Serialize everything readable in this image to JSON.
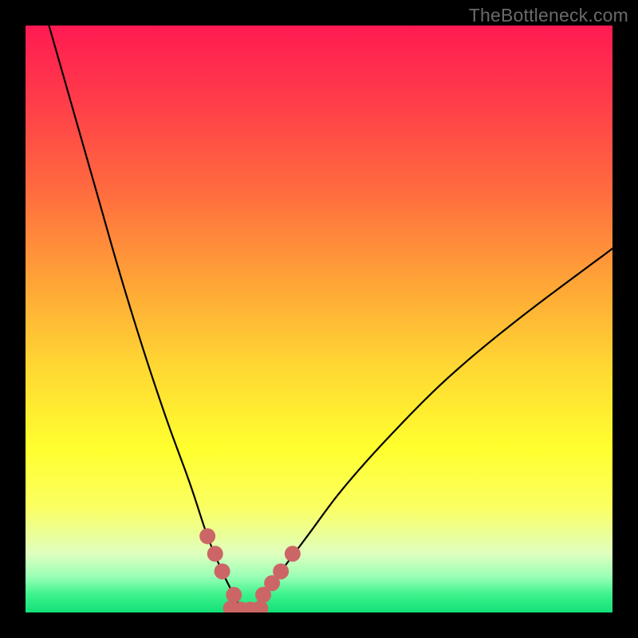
{
  "watermark": "TheBottleneck.com",
  "chart_data": {
    "type": "line",
    "title": "",
    "xlabel": "",
    "ylabel": "",
    "xlim": [
      0,
      100
    ],
    "ylim": [
      0,
      100
    ],
    "grid": false,
    "series": [
      {
        "name": "bottleneck-curve",
        "x": [
          4,
          8,
          12,
          16,
          20,
          24,
          28,
          31,
          33.5,
          35.5,
          37,
          38.5,
          40.5,
          43.5,
          48,
          54,
          62,
          72,
          84,
          100
        ],
        "y": [
          100,
          86,
          72,
          58,
          45,
          33,
          22,
          13,
          7,
          3,
          0.5,
          0.5,
          3,
          7,
          13,
          21,
          30,
          40,
          50,
          62
        ]
      }
    ],
    "markers": [
      {
        "x": 31.0,
        "y": 13.0
      },
      {
        "x": 32.3,
        "y": 10.0
      },
      {
        "x": 33.5,
        "y": 7.0
      },
      {
        "x": 35.5,
        "y": 3.0
      },
      {
        "x": 35.0,
        "y": 0.7
      },
      {
        "x": 36.7,
        "y": 0.5
      },
      {
        "x": 38.3,
        "y": 0.5
      },
      {
        "x": 40.0,
        "y": 0.7
      },
      {
        "x": 40.5,
        "y": 3.0
      },
      {
        "x": 42.0,
        "y": 5.0
      },
      {
        "x": 43.5,
        "y": 7.0
      },
      {
        "x": 45.5,
        "y": 10.0
      }
    ],
    "gradient_stops": [
      {
        "pos": 0.0,
        "color": "#ff1a52"
      },
      {
        "pos": 0.12,
        "color": "#ff3a4a"
      },
      {
        "pos": 0.28,
        "color": "#ff6b3f"
      },
      {
        "pos": 0.44,
        "color": "#ffa537"
      },
      {
        "pos": 0.58,
        "color": "#ffd733"
      },
      {
        "pos": 0.72,
        "color": "#ffff2e"
      },
      {
        "pos": 0.82,
        "color": "#fbff61"
      },
      {
        "pos": 0.9,
        "color": "#dfffbf"
      },
      {
        "pos": 0.94,
        "color": "#97ffb5"
      },
      {
        "pos": 0.97,
        "color": "#3cf28a"
      },
      {
        "pos": 1.0,
        "color": "#14e07a"
      }
    ],
    "marker_color": "#cc6666",
    "curve_color": "#000000"
  }
}
